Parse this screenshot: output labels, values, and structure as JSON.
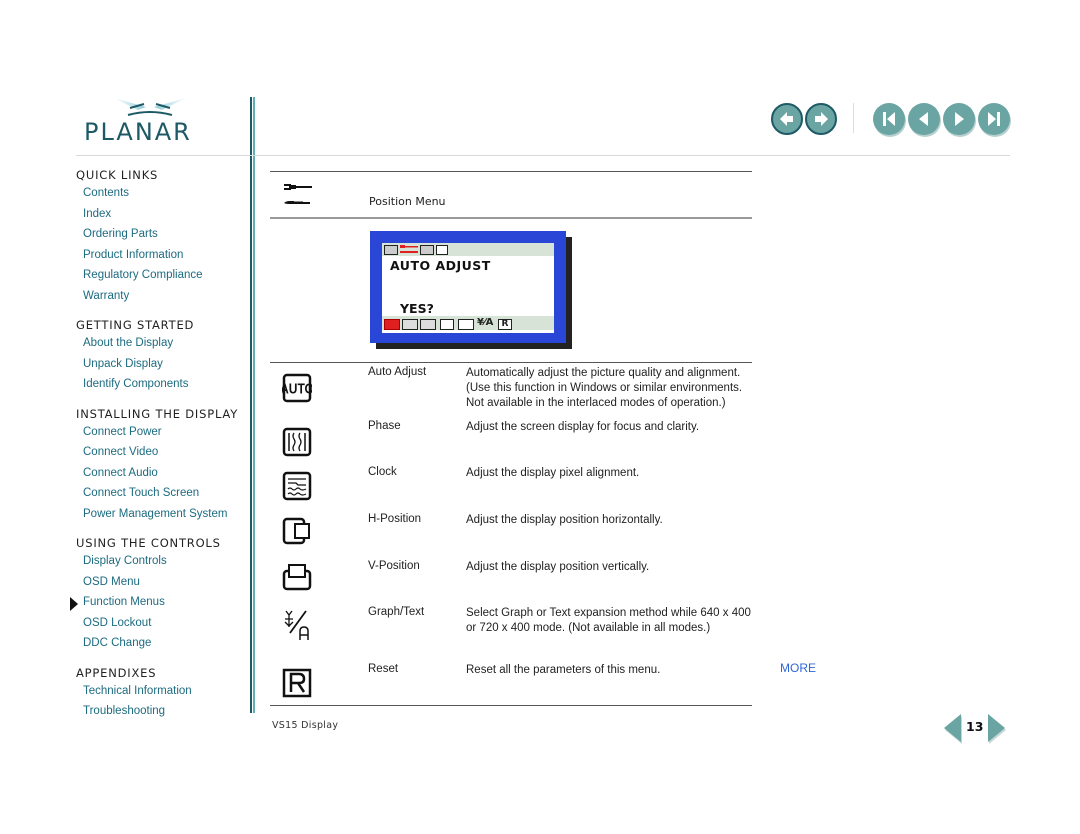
{
  "brand": {
    "name": "PLANAR",
    "color": "#1e5a66",
    "accent": "#6aa5a3"
  },
  "sidebar": {
    "sections": [
      {
        "title": "QUICK LINKS",
        "items": [
          {
            "label": "Contents"
          },
          {
            "label": "Index"
          },
          {
            "label": "Ordering Parts"
          },
          {
            "label": "Product Information"
          },
          {
            "label": "Regulatory Compliance"
          },
          {
            "label": "Warranty"
          }
        ]
      },
      {
        "title": "GETTING STARTED",
        "items": [
          {
            "label": "About the Display"
          },
          {
            "label": "Unpack Display"
          },
          {
            "label": "Identify Components"
          }
        ]
      },
      {
        "title": "INSTALLING THE DISPLAY",
        "items": [
          {
            "label": "Connect Power"
          },
          {
            "label": "Connect Video"
          },
          {
            "label": "Connect Audio"
          },
          {
            "label": "Connect Touch Screen"
          },
          {
            "label": "Power Management System"
          }
        ]
      },
      {
        "title": "USING THE CONTROLS",
        "items": [
          {
            "label": "Display Controls"
          },
          {
            "label": "OSD Menu"
          },
          {
            "label": "Function Menus",
            "active": true
          },
          {
            "label": "OSD Lockout"
          },
          {
            "label": "DDC Change"
          }
        ]
      },
      {
        "title": "APPENDIXES",
        "items": [
          {
            "label": "Technical Information"
          },
          {
            "label": "Troubleshooting"
          }
        ]
      }
    ]
  },
  "navigation": {
    "buttons": [
      {
        "name": "back",
        "icon": "arrow-left-icon"
      },
      {
        "name": "forward",
        "icon": "arrow-right-icon"
      },
      {
        "name": "first-page",
        "icon": "first-page-icon"
      },
      {
        "name": "previous-page",
        "icon": "previous-page-icon"
      },
      {
        "name": "next-page",
        "icon": "next-page-icon"
      },
      {
        "name": "last-page",
        "icon": "last-page-icon"
      }
    ]
  },
  "content": {
    "menu_title": "Position Menu",
    "menu_icon": "position-menu-icon",
    "osd": {
      "title": "AUTO ADJUST",
      "prompt": "YES?",
      "frame_color": "#2a46d6",
      "highlight_color": "#e02020"
    },
    "functions": [
      {
        "name": "Auto Adjust",
        "icon": "auto-adjust-icon",
        "description": "Automatically adjust the picture quality and alignment. (Use this function in Windows or similar environments. Not available in the interlaced modes of operation.)"
      },
      {
        "name": "Phase",
        "icon": "phase-icon",
        "description": "Adjust the screen display for focus and clarity."
      },
      {
        "name": "Clock",
        "icon": "clock-icon",
        "description": "Adjust the display pixel alignment."
      },
      {
        "name": "H-Position",
        "icon": "h-position-icon",
        "description": "Adjust the display position horizontally."
      },
      {
        "name": "V-Position",
        "icon": "v-position-icon",
        "description": "Adjust the display position vertically."
      },
      {
        "name": "Graph/Text",
        "icon": "graph-text-icon",
        "description": "Select Graph or Text expansion method while 640 x 400 or 720 x 400 mode. (Not available in all modes.)"
      },
      {
        "name": "Reset",
        "icon": "reset-icon",
        "description": "Reset all the parameters of this menu."
      }
    ],
    "more_label": "MORE",
    "more_color": "#2f66d8"
  },
  "footer": {
    "product": "VS15 Display",
    "page_number": "13"
  }
}
